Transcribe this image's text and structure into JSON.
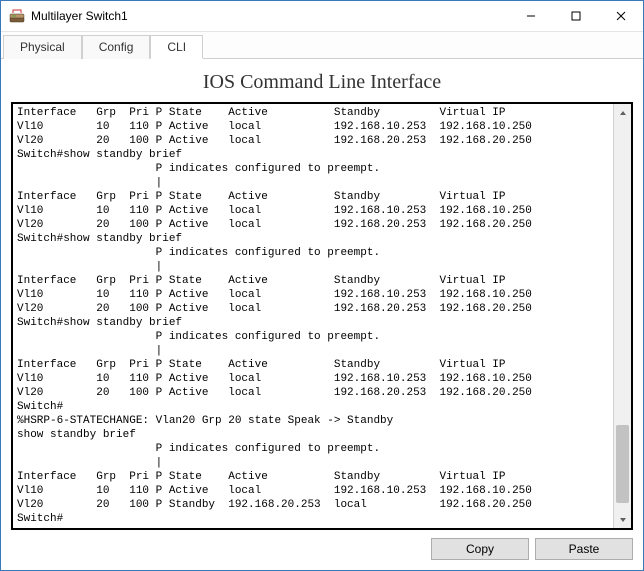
{
  "window": {
    "title": "Multilayer Switch1"
  },
  "tabs": {
    "items": [
      {
        "label": "Physical"
      },
      {
        "label": "Config"
      },
      {
        "label": "CLI"
      }
    ],
    "active_index": 2
  },
  "cli": {
    "heading": "IOS Command Line Interface",
    "output": "Interface   Grp  Pri P State    Active          Standby         Virtual IP\nVl10        10   110 P Active   local           192.168.10.253  192.168.10.250\nVl20        20   100 P Active   local           192.168.20.253  192.168.20.250\nSwitch#show standby brief\n                     P indicates configured to preempt.\n                     |\nInterface   Grp  Pri P State    Active          Standby         Virtual IP\nVl10        10   110 P Active   local           192.168.10.253  192.168.10.250\nVl20        20   100 P Active   local           192.168.20.253  192.168.20.250\nSwitch#show standby brief\n                     P indicates configured to preempt.\n                     |\nInterface   Grp  Pri P State    Active          Standby         Virtual IP\nVl10        10   110 P Active   local           192.168.10.253  192.168.10.250\nVl20        20   100 P Active   local           192.168.20.253  192.168.20.250\nSwitch#show standby brief\n                     P indicates configured to preempt.\n                     |\nInterface   Grp  Pri P State    Active          Standby         Virtual IP\nVl10        10   110 P Active   local           192.168.10.253  192.168.10.250\nVl20        20   100 P Active   local           192.168.20.253  192.168.20.250\nSwitch#\n%HSRP-6-STATECHANGE: Vlan20 Grp 20 state Speak -> Standby\nshow standby brief\n                     P indicates configured to preempt.\n                     |\nInterface   Grp  Pri P State    Active          Standby         Virtual IP\nVl10        10   110 P Active   local           192.168.10.253  192.168.10.250\nVl20        20   100 P Standby  192.168.20.253  local           192.168.20.250\nSwitch#"
  },
  "buttons": {
    "copy": "Copy",
    "paste": "Paste"
  }
}
